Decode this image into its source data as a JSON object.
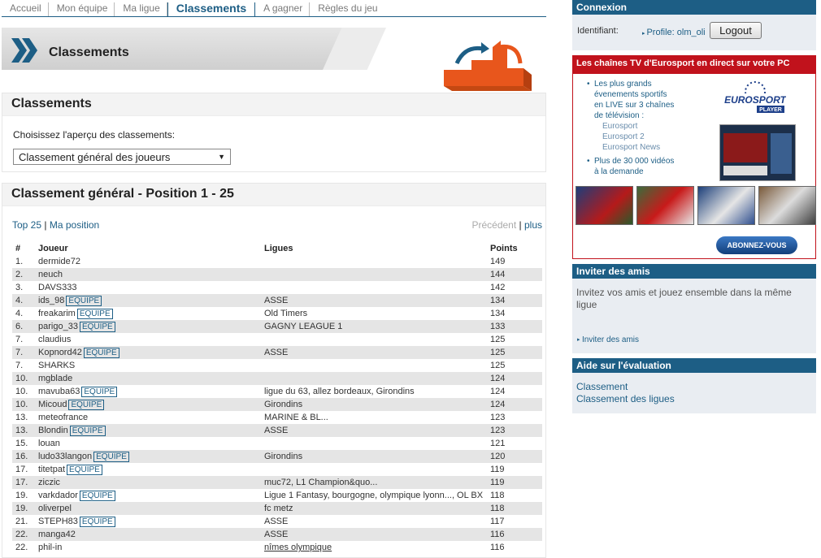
{
  "nav": {
    "items": [
      "Accueil",
      "Mon équipe",
      "Ma ligue",
      "Classements",
      "A gagner",
      "Règles du jeu"
    ],
    "active_index": 3
  },
  "banner": {
    "title": "Classements"
  },
  "classements_panel": {
    "title": "Classements",
    "label": "Choisissez l'aperçu des classements:",
    "select_value": "Classement général des joueurs"
  },
  "ranking_panel": {
    "title": "Classement général - Position 1 - 25",
    "top25": "Top 25",
    "separator": "|",
    "my_position": "Ma position",
    "previous": "Précédent",
    "more": "plus",
    "columns": [
      "#",
      "Joueur",
      "Ligues",
      "Points"
    ],
    "badge_label": "EQUIPE",
    "rows": [
      {
        "rank": "1.",
        "player": "dermide72",
        "team": false,
        "leagues": "",
        "points": "149"
      },
      {
        "rank": "2.",
        "player": "neuch",
        "team": false,
        "leagues": "",
        "points": "144"
      },
      {
        "rank": "3.",
        "player": "DAVS333",
        "team": false,
        "leagues": "",
        "points": "142"
      },
      {
        "rank": "4.",
        "player": "ids_98",
        "team": true,
        "leagues": "ASSE",
        "points": "134"
      },
      {
        "rank": "4.",
        "player": "freakarim",
        "team": true,
        "leagues": "Old Timers",
        "points": "134"
      },
      {
        "rank": "6.",
        "player": "parigo_33",
        "team": true,
        "leagues": "GAGNY LEAGUE 1",
        "points": "133"
      },
      {
        "rank": "7.",
        "player": "claudius",
        "team": false,
        "leagues": "",
        "points": "125"
      },
      {
        "rank": "7.",
        "player": "Kopnord42",
        "team": true,
        "leagues": "ASSE",
        "points": "125"
      },
      {
        "rank": "7.",
        "player": "SHARKS",
        "team": false,
        "leagues": "",
        "points": "125"
      },
      {
        "rank": "10.",
        "player": "mgblade",
        "team": false,
        "leagues": "",
        "points": "124"
      },
      {
        "rank": "10.",
        "player": "mavuba63",
        "team": true,
        "leagues": "ligue du 63, allez bordeaux, Girondins",
        "points": "124"
      },
      {
        "rank": "10.",
        "player": "Micoud",
        "team": true,
        "leagues": "Girondins",
        "points": "124"
      },
      {
        "rank": "13.",
        "player": "meteofrance",
        "team": false,
        "leagues": "MARINE & BL...",
        "points": "123"
      },
      {
        "rank": "13.",
        "player": "Blondin",
        "team": true,
        "leagues": "ASSE",
        "points": "123"
      },
      {
        "rank": "15.",
        "player": "louan",
        "team": false,
        "leagues": "",
        "points": "121"
      },
      {
        "rank": "16.",
        "player": "ludo33langon",
        "team": true,
        "leagues": "Girondins",
        "points": "120"
      },
      {
        "rank": "17.",
        "player": "titetpat",
        "team": true,
        "leagues": "",
        "points": "119"
      },
      {
        "rank": "17.",
        "player": "ziczic",
        "team": false,
        "leagues": "muc72, L1 Champion&quo...",
        "points": "119"
      },
      {
        "rank": "19.",
        "player": "varkdador",
        "team": true,
        "leagues": "Ligue 1 Fantasy, bourgogne, olympique lyonn..., OL BX",
        "points": "118"
      },
      {
        "rank": "19.",
        "player": "oliverpel",
        "team": false,
        "leagues": "fc metz",
        "points": "118"
      },
      {
        "rank": "21.",
        "player": "STEPH83",
        "team": true,
        "leagues": "ASSE",
        "points": "117"
      },
      {
        "rank": "22.",
        "player": "manga42",
        "team": false,
        "leagues": "ASSE",
        "points": "116"
      },
      {
        "rank": "22.",
        "player": "phil-in",
        "team": false,
        "leagues": "nîmes olympique",
        "points": "116",
        "league_link": true
      }
    ]
  },
  "connexion": {
    "title": "Connexion",
    "id_label": "Identifiant:",
    "profile": "Profile: olm_oli",
    "logout": "Logout"
  },
  "ad": {
    "title": "Les chaînes TV d'Eurosport en direct sur votre PC",
    "line1": "Les plus grands",
    "line2": "évenements sportifs",
    "line3": "en LIVE sur 3 chaînes",
    "line4": "de télévision :",
    "channels": [
      "Eurosport",
      "Eurosport 2",
      "Eurosport News"
    ],
    "line5": "Plus de 30 000 vidéos",
    "line6": "à la demande",
    "logo_text": "EUROSPORT",
    "logo_sub": "PLAYER",
    "cta": "ABONNEZ-VOUS"
  },
  "invite": {
    "title": "Inviter des amis",
    "text": "Invitez vos amis et jouez ensemble dans la même ligue",
    "link": "Inviter des amis"
  },
  "aide": {
    "title": "Aide sur l'évaluation",
    "links": [
      "Classement",
      "Classement des ligues"
    ]
  }
}
